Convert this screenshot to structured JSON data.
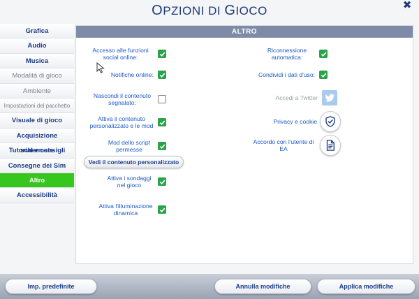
{
  "header": {
    "title_first": "O",
    "title_rest": "PZIONI DI ",
    "title_second": "G",
    "title_end": "IOCO",
    "close_glyph": "✖"
  },
  "sidebar": {
    "items": [
      {
        "label": "Grafica"
      },
      {
        "label": "Audio"
      },
      {
        "label": "Musica"
      },
      {
        "label": "Modalità di gioco"
      },
      {
        "label": "Ambiente"
      },
      {
        "label": "Impostazioni del pacchetto"
      },
      {
        "label": "Visuale di gioco"
      },
      {
        "label": "Acquisizione schermate"
      },
      {
        "label": "Tutorial e consigli"
      },
      {
        "label": "Consegne dei Sim"
      },
      {
        "label": "Altro"
      },
      {
        "label": "Accessibilità"
      }
    ],
    "active_index": 10
  },
  "panel": {
    "title": "ALTRO",
    "left_options": [
      {
        "label": "Accesso alle funzioni social online:",
        "checked": true
      },
      {
        "label": "Notifiche online:",
        "checked": true
      },
      {
        "label": "Nascondi il contenuto segnalato:",
        "checked": false
      },
      {
        "label": "Attiva il contenuto personalizzato e le mod",
        "checked": true
      },
      {
        "label": "Mod dello script permesse",
        "checked": true
      },
      {
        "label": "Attiva i sondaggi nel gioco",
        "checked": true
      },
      {
        "label": "Attiva l'illuminazione dinamica",
        "checked": true
      }
    ],
    "custom_content_button": "Vedi il contenuto personalizzato",
    "right_options": [
      {
        "label": "Riconnessione automatica:",
        "checked": true
      },
      {
        "label": "Condividi i dati d'uso:",
        "checked": true
      }
    ],
    "twitter_label": "Accedi a Twitter",
    "privacy_label": "Privacy e cookie",
    "agreement_label": "Accordo con l'utente di EA",
    "icons": {
      "twitter": "twitter-icon",
      "privacy": "shield-check-icon",
      "agreement": "document-icon"
    }
  },
  "footer": {
    "defaults_button": "Imp. predefinite",
    "cancel_button": "Annulla modifiche",
    "apply_button": "Applica modifiche"
  },
  "colors": {
    "accent_active": "#36c61e",
    "check_green": "#2aa44a",
    "label_blue": "#1c59c8",
    "header_gray": "#7e8ba6"
  }
}
